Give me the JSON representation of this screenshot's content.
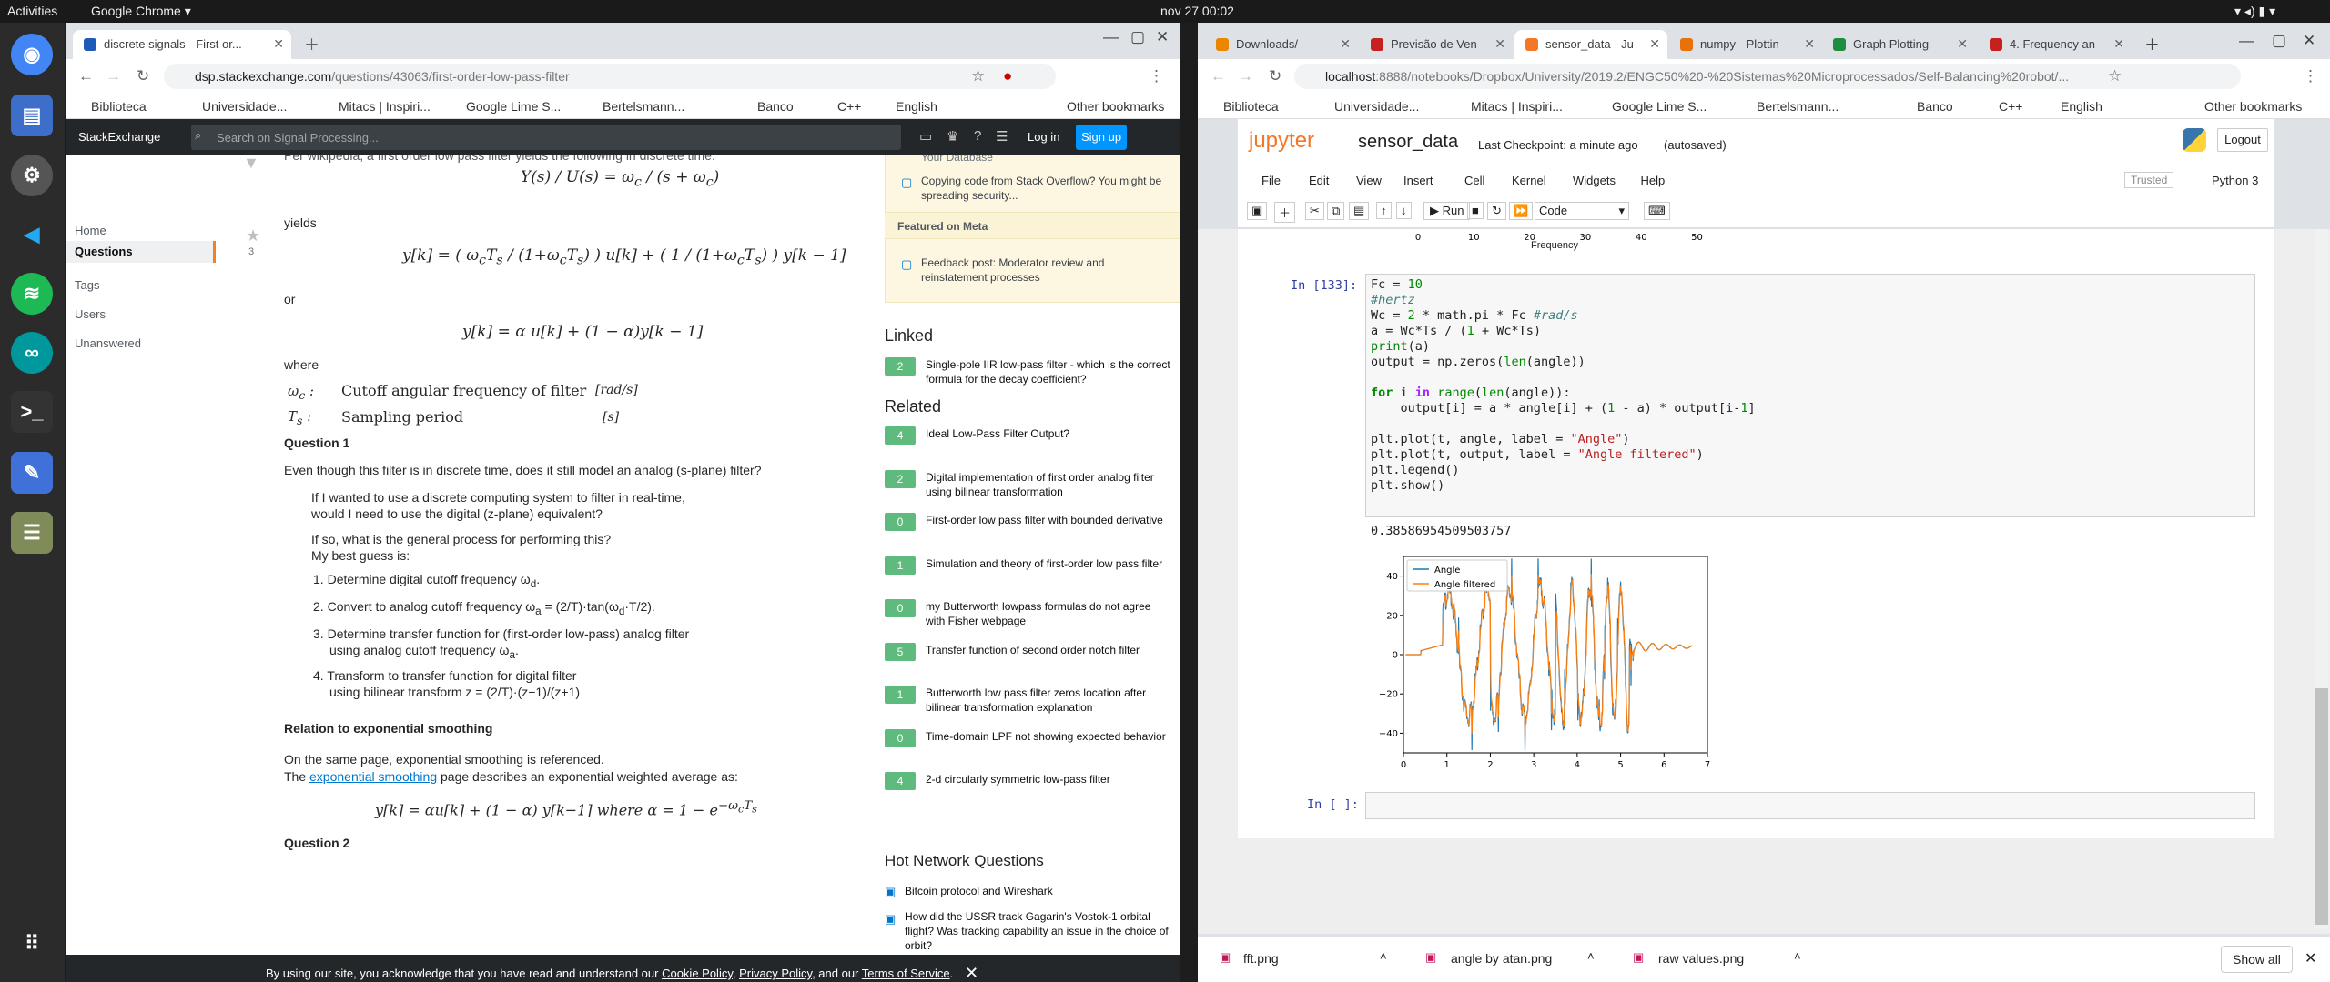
{
  "topbar": {
    "activities": "Activities",
    "app": "Google Chrome ▾",
    "clock": "nov 27  00:02"
  },
  "left": {
    "tab1": "discrete signals - First or...",
    "url_host": "dsp.stackexchange.com",
    "url_path": "/questions/43063/first-order-low-pass-filter",
    "bookmarks": [
      "Biblioteca",
      "Universidade...",
      "Mitacs | Inspiri...",
      "Google Lime S...",
      "Bertelsmann...",
      "Banco",
      "C++",
      "English"
    ],
    "other_bm": "Other bookmarks",
    "se_logo": "StackExchange",
    "search_ph": "Search on Signal Processing...",
    "login": "Log in",
    "signup": "Sign up",
    "nav": [
      "Home",
      "Questions",
      "Tags",
      "Users",
      "Unanswered"
    ],
    "vote": "3",
    "p_intro": "Per wikipedia, a first order low pass filter yields the following in discrete time:",
    "yields": "yields",
    "or": "or",
    "where": "where",
    "wc_label": "Cutoff angular frequency of filter",
    "ts_label": "Sampling period",
    "q1": "Question 1",
    "q1_text": "Even though this filter is in discrete time, does it still model an analog (s-plane) filter?",
    "b1a": "If I wanted to use a discrete computing system to filter in real-time,",
    "b1b": "would I need to use the digital (z-plane) equivalent?",
    "b2a": "If so, what is the general process for performing this?",
    "b2b": "My best guess is:",
    "o1": "Determine digital cutoff frequency ω",
    "o2": "Convert to analog cutoff frequency ω",
    "o3a": "Determine transfer function for (first-order low-pass) analog filter",
    "o3b": "using analog cutoff frequency ω",
    "o4a": "Transform to transfer function for digital filter",
    "o4b": "using bilinear transform z =",
    "rel": "Relation to exponential smoothing",
    "rel1": "On the same page, exponential smoothing is referenced.",
    "rel2a": "The",
    "rel2b": "exponential smoothing",
    "rel2c": "page describes an exponential weighted average as:",
    "q2": "Question 2",
    "side_top": "Your Database",
    "side_c1": "Copying code from Stack Overflow? You might be spreading security...",
    "featured": "Featured on Meta",
    "side_c2": "Feedback post: Moderator review and reinstatement processes",
    "linked": "Linked",
    "linked_items": [
      {
        "n": "2",
        "t": "Single-pole IIR low-pass filter - which is the correct formula for the decay coefficient?"
      }
    ],
    "related": "Related",
    "related_items": [
      {
        "n": "4",
        "t": "Ideal Low-Pass Filter Output?"
      },
      {
        "n": "2",
        "t": "Digital implementation of first order analog filter using bilinear transformation"
      },
      {
        "n": "0",
        "t": "First-order low pass filter with bounded derivative"
      },
      {
        "n": "1",
        "t": "Simulation and theory of first-order low pass filter"
      },
      {
        "n": "0",
        "t": "my Butterworth lowpass formulas do not agree with Fisher webpage"
      },
      {
        "n": "5",
        "t": "Transfer function of second order notch filter"
      },
      {
        "n": "1",
        "t": "Butterworth low pass filter zeros location after bilinear transformation explanation"
      },
      {
        "n": "0",
        "t": "Time-domain LPF not showing expected behavior"
      },
      {
        "n": "4",
        "t": "2-d circularly symmetric low-pass filter"
      }
    ],
    "hot": "Hot Network Questions",
    "hot_items": [
      "Bitcoin protocol and Wireshark",
      "How did the USSR track Gagarin's Vostok-1 orbital flight? Was tracking capability an issue in the choice of orbit?"
    ],
    "cookie_a": "By using our site, you acknowledge that you have read and understand our",
    "cookie_b": "Cookie Policy",
    "cookie_c": "Privacy Policy",
    "cookie_d": "Terms of Service"
  },
  "right": {
    "tabs": [
      "Downloads/",
      "Previsão de Ven",
      "sensor_data - Ju",
      "numpy - Plottin",
      "Graph Plotting",
      "4. Frequency an"
    ],
    "url_host": "localhost",
    "url_path": ":8888/notebooks/Dropbox/University/2019.2/ENGC50%20-%20Sistemas%20Microprocessados/Self-Balancing%20robot/...",
    "jupyter": "jupyter",
    "nbname": "sensor_data",
    "checkpoint": "Last Checkpoint: a minute ago",
    "autosaved": "(autosaved)",
    "logout": "Logout",
    "menu": [
      "File",
      "Edit",
      "View",
      "Insert",
      "Cell",
      "Kernel",
      "Widgets",
      "Help"
    ],
    "trusted": "Trusted",
    "kernel": "Python 3",
    "run": "Run",
    "celltype": "Code",
    "prev_ticks": [
      "0",
      "10",
      "20",
      "30",
      "40",
      "50"
    ],
    "prev_xlabel": "Frequency",
    "prompt": "In [133]:",
    "prompt_empty": "In [ ]:",
    "output_val": "0.38586954509503757",
    "dl": [
      "fft.png",
      "angle by atan.png",
      "raw values.png"
    ],
    "showall": "Show all"
  },
  "chart_data": {
    "type": "line",
    "series": [
      {
        "name": "Angle"
      },
      {
        "name": "Angle filtered"
      }
    ],
    "xlim": [
      0,
      7
    ],
    "ylim": [
      -50,
      50
    ],
    "xticks": [
      "0",
      "1",
      "2",
      "3",
      "4",
      "5",
      "6",
      "7"
    ],
    "yticks": [
      "40",
      "20",
      "0",
      "−20",
      "−40"
    ],
    "legend": "top-left",
    "colors": [
      "#1f77b4",
      "#ff7f0e"
    ]
  }
}
